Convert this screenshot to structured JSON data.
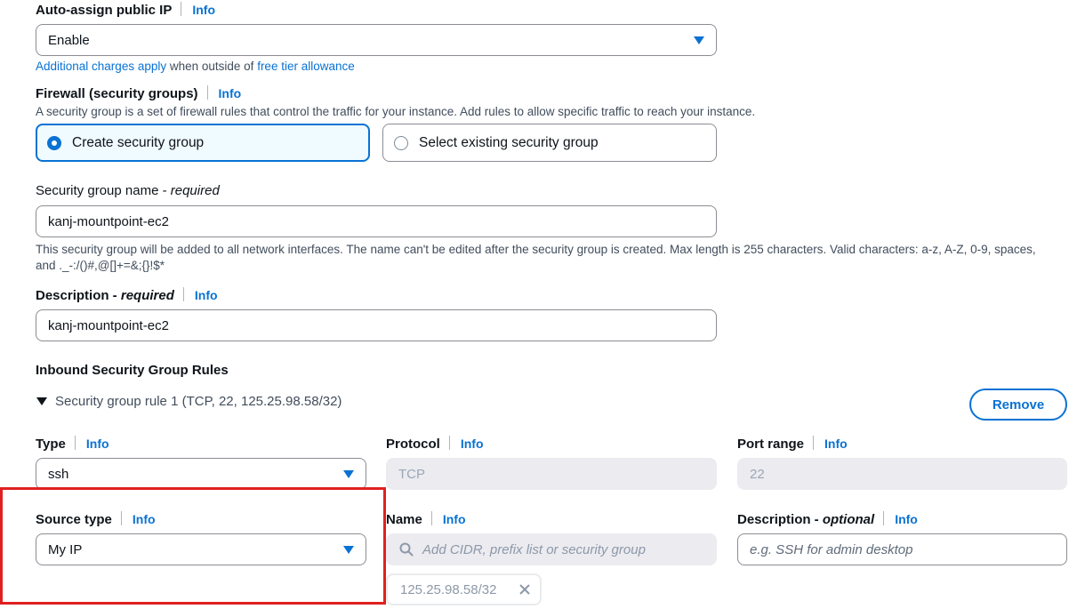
{
  "auto_assign": {
    "label": "Auto-assign public IP",
    "info": "Info",
    "value": "Enable",
    "charges_link": "Additional charges apply",
    "charges_middle": " when outside of ",
    "free_tier_link": "free tier allowance"
  },
  "firewall": {
    "label": "Firewall (security groups)",
    "info": "Info",
    "description": "A security group is a set of firewall rules that control the traffic for your instance. Add rules to allow specific traffic to reach your instance.",
    "option_create": "Create security group",
    "option_existing": "Select existing security group"
  },
  "sg_name": {
    "label": "Security group name - ",
    "required": "required",
    "value": "kanj-mountpoint-ec2",
    "help_line1": "This security group will be added to all network interfaces. The name can't be edited after the security group is created. Max length is 255 characters. Valid characters: a-z, A-Z, 0-9, spaces,",
    "help_line2": "and ._-:/()#,@[]+=&;{}!$*"
  },
  "sg_description": {
    "label": "Description - ",
    "required": "required",
    "info": "Info",
    "value": "kanj-mountpoint-ec2"
  },
  "inbound": {
    "heading": "Inbound Security Group Rules",
    "rule_title": "Security group rule 1 (TCP, 22, 125.25.98.58/32)",
    "remove_label": "Remove",
    "type": {
      "label": "Type",
      "info": "Info",
      "value": "ssh"
    },
    "protocol": {
      "label": "Protocol",
      "info": "Info",
      "value": "TCP"
    },
    "port_range": {
      "label": "Port range",
      "info": "Info",
      "value": "22"
    },
    "source_type": {
      "label": "Source type",
      "info": "Info",
      "value": "My IP"
    },
    "name": {
      "label": "Name",
      "info": "Info",
      "placeholder": "Add CIDR, prefix list or security group",
      "token": "125.25.98.58/32"
    },
    "description": {
      "label": "Description - ",
      "optional": "optional",
      "info": "Info",
      "placeholder": "e.g. SSH for admin desktop"
    }
  },
  "colors": {
    "accent": "#0972d3",
    "highlight": "#e02020"
  },
  "icons": [
    "caret-down-icon",
    "search-icon",
    "close-icon",
    "expand-triangle-icon",
    "radio-icon"
  ]
}
